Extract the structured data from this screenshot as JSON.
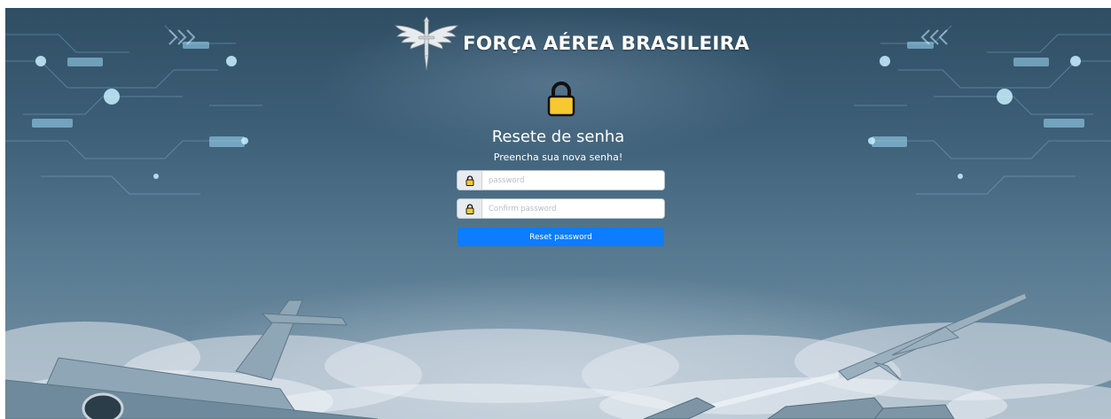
{
  "header": {
    "brand": "FORÇA AÉREA BRASILEIRA",
    "emblem_icon": "air-force-wings-sword-emblem"
  },
  "main": {
    "lock_icon": "padlock-icon",
    "title": "Resete de senha",
    "subtitle": "Preencha sua nova senha!"
  },
  "form": {
    "password": {
      "placeholder": "password",
      "value": "",
      "icon": "padlock-icon"
    },
    "confirm_password": {
      "placeholder": "Confirm password",
      "value": "",
      "icon": "padlock-icon"
    },
    "submit_label": "Reset password"
  },
  "colors": {
    "button": "#0d7cff",
    "lock_body": "#f7c830",
    "background_top": "#2f4e64",
    "background_bottom": "#7893a6"
  }
}
